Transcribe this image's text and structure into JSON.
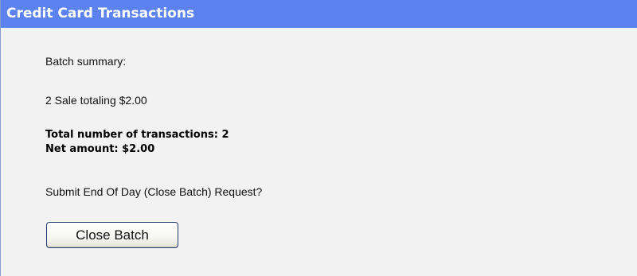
{
  "panel": {
    "title": "Credit Card Transactions"
  },
  "summary": {
    "heading": "Batch summary:",
    "sale_line": "2 Sale totaling $2.00",
    "total_transactions": "Total number of transactions: 2",
    "net_amount": "Net amount: $2.00"
  },
  "prompt": {
    "question": "Submit End Of Day (Close Batch) Request?"
  },
  "actions": {
    "close_batch_label": "Close Batch"
  },
  "colors": {
    "title_bar": "#5b82ee",
    "panel_background": "#f2f2f2",
    "button_border": "#1f3a6e"
  }
}
